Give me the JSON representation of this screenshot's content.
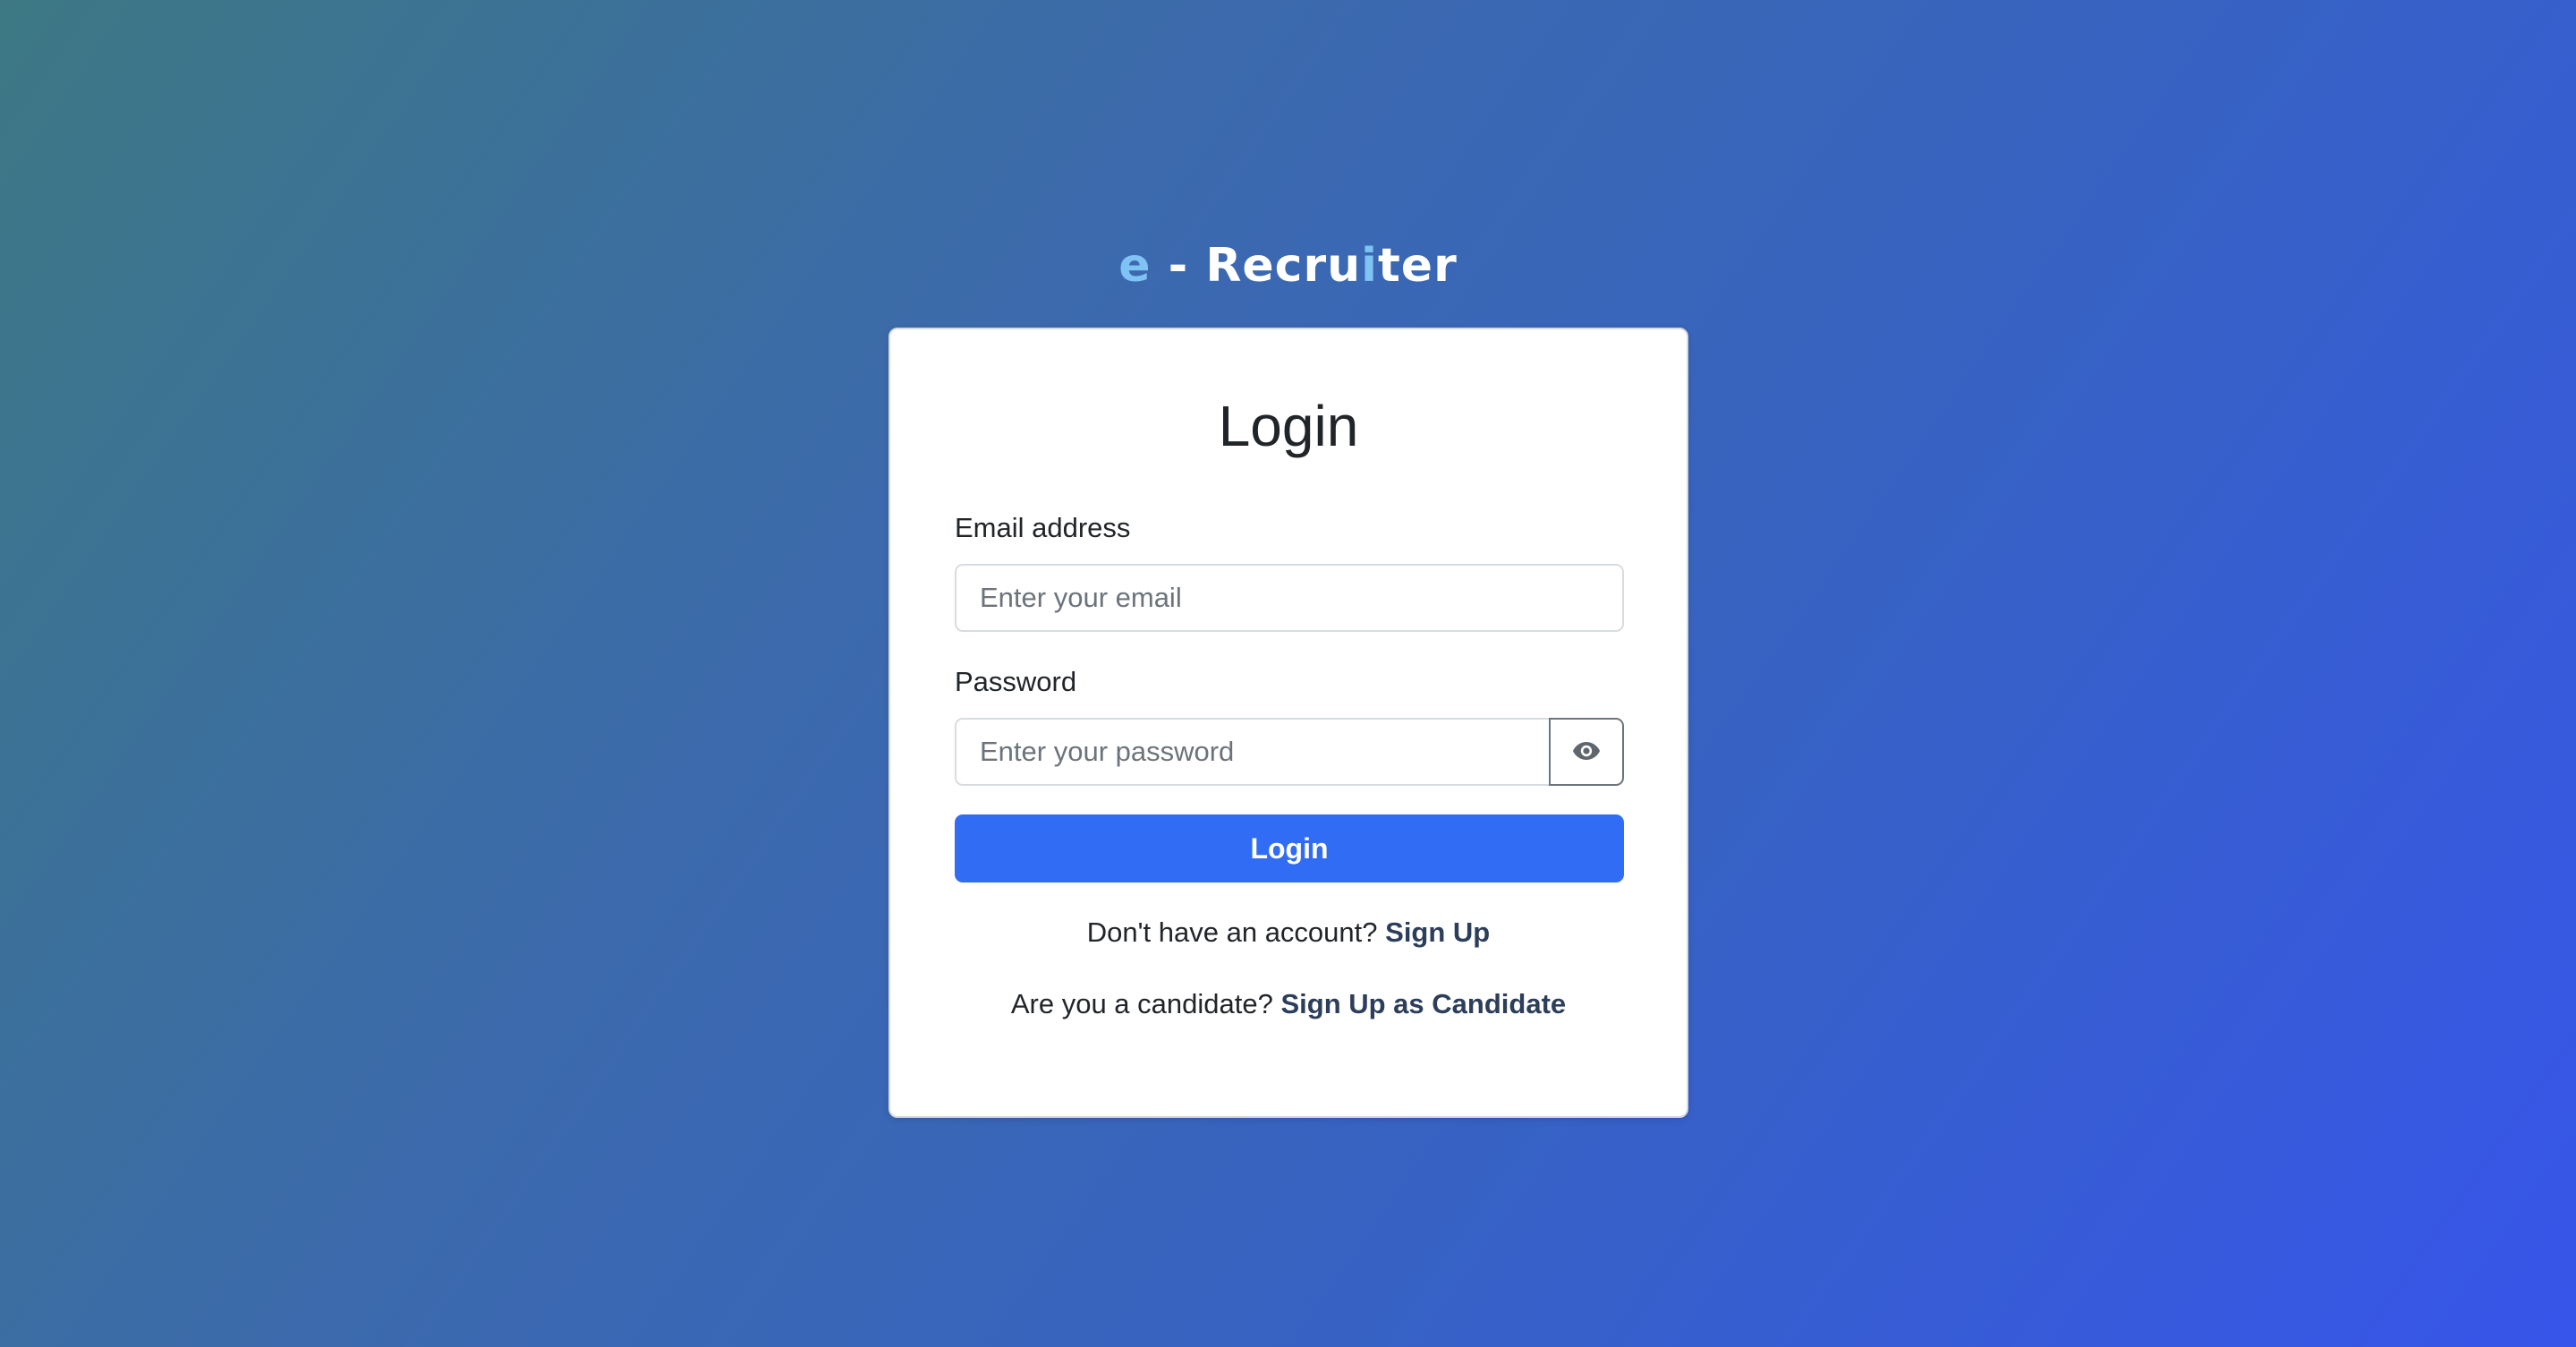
{
  "brand": {
    "part_e": "e",
    "separator": "- Recru",
    "part_i": "i",
    "part_end": "ter"
  },
  "login": {
    "title": "Login",
    "email_label": "Email address",
    "email_placeholder": "Enter your email",
    "email_value": "",
    "password_label": "Password",
    "password_placeholder": "Enter your password",
    "password_value": "",
    "toggle_icon": "eye-icon",
    "submit_label": "Login",
    "signup_prompt": "Don't have an account?",
    "signup_link": "Sign Up",
    "candidate_prompt": "Are you a candidate?",
    "candidate_link": "Sign Up as Candidate"
  },
  "colors": {
    "primary": "#316cf4",
    "link": "#2c3e5a",
    "brand_accent": "#7fc3f4"
  }
}
